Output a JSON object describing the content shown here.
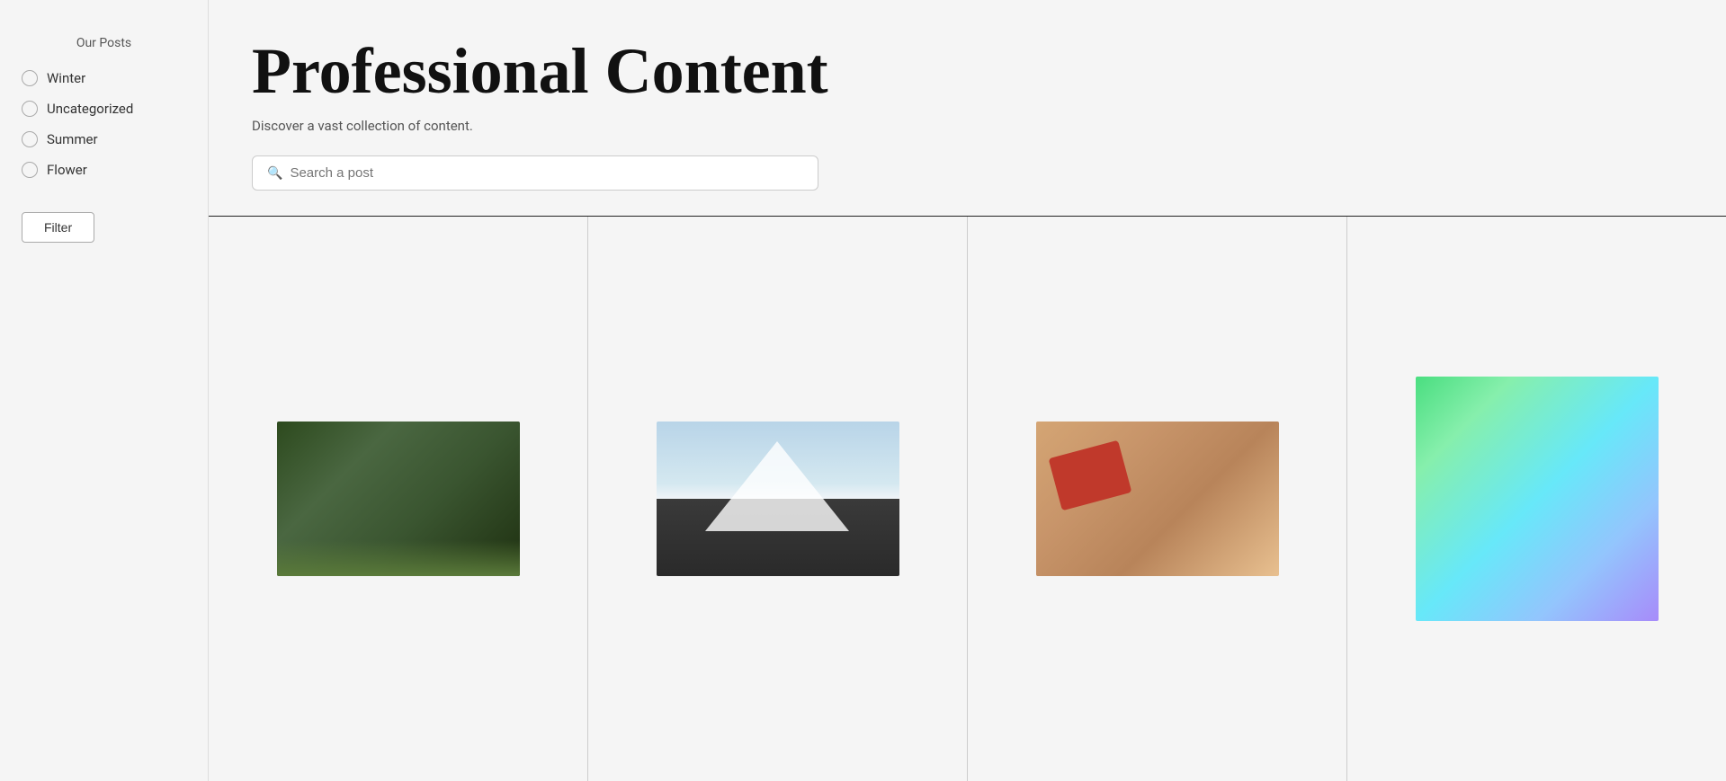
{
  "sidebar": {
    "title": "Our Posts",
    "items": [
      {
        "id": "winter",
        "label": "Winter"
      },
      {
        "id": "uncategorized",
        "label": "Uncategorized"
      },
      {
        "id": "summer",
        "label": "Summer"
      },
      {
        "id": "flower",
        "label": "Flower"
      }
    ],
    "filter_button": "Filter"
  },
  "header": {
    "title": "Professional Content",
    "subtitle": "Discover a vast collection of content.",
    "search_placeholder": "Search a post"
  },
  "grid": {
    "columns": [
      {
        "id": "col-1",
        "image_type": "forest"
      },
      {
        "id": "col-2",
        "image_type": "mountain"
      },
      {
        "id": "col-3",
        "image_type": "desk"
      },
      {
        "id": "col-4",
        "image_type": "gradient"
      }
    ]
  }
}
